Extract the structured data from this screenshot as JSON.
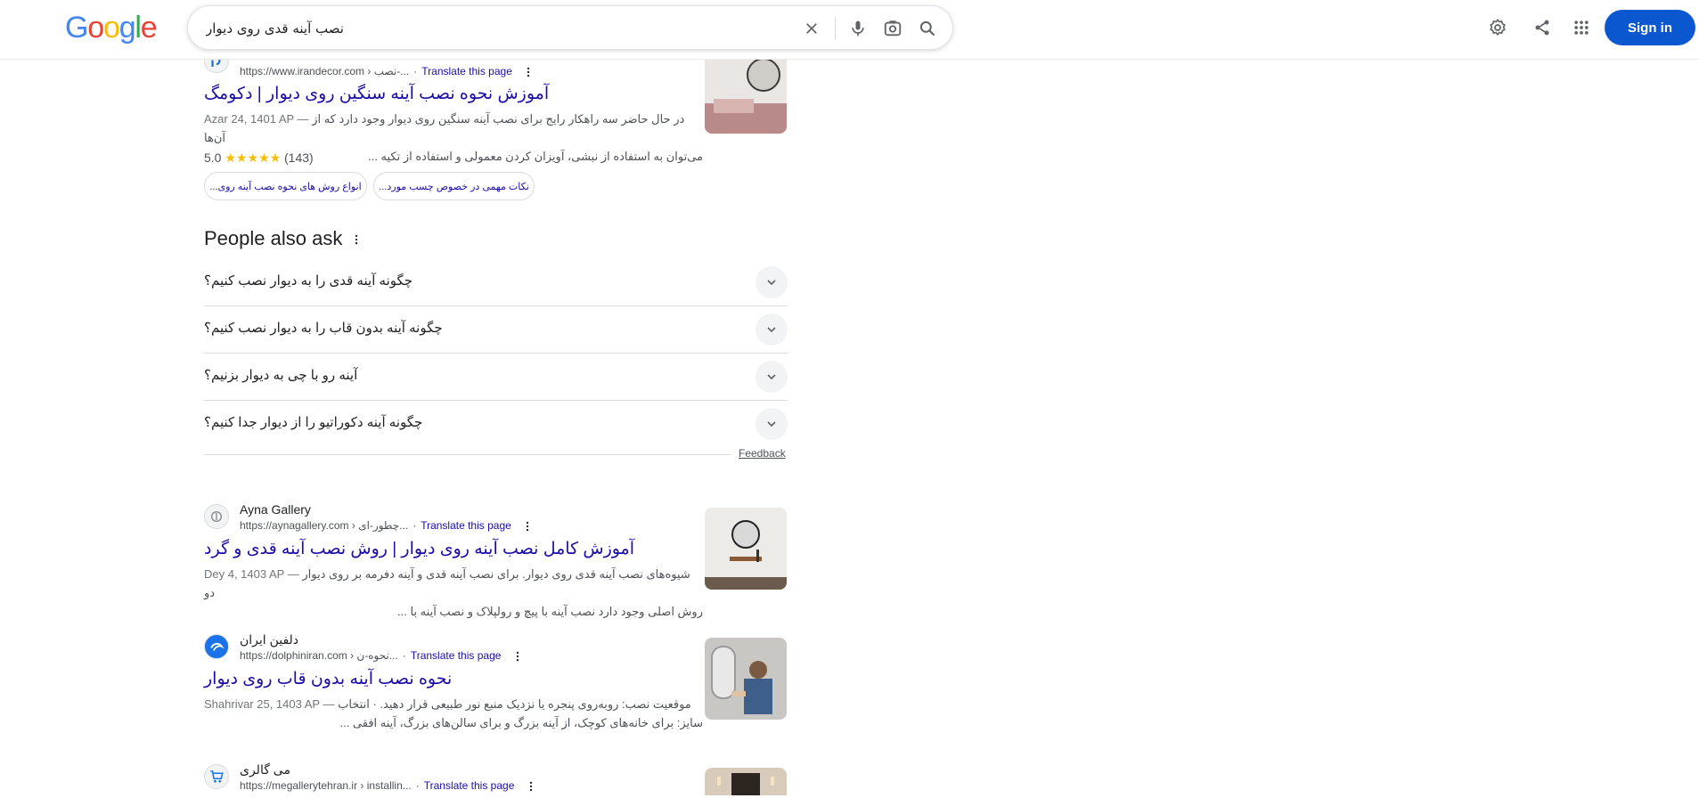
{
  "logo": "Google",
  "search": {
    "query": "نصب آینه قدی روی دیوار"
  },
  "header": {
    "sign_in_label": "Sign in"
  },
  "results_top": {
    "url_host": "https://www.irandecor.com",
    "url_path": " › نصب-...",
    "translate": "Translate this page",
    "title": "آموزش نحوه نصب آینه سنگین روی دیوار | دکومگ",
    "date": "Azar 24, 1401 AP —",
    "snippet_line1": "در حال حاضر سه راهکار رایج برای نصب آینه سنگین روی دیوار وجود دارد که از آن‌ها",
    "snippet_line2": "می‌توان به استفاده از نبشی، آویزان کردن معمولی و استفاده از تکیه ...",
    "rating": "5.0",
    "stars": "★★★★★",
    "rating_count": "(143)",
    "chips": [
      "انواع روش های نحوه نصب آینه روی...",
      "نکات مهمی در خصوص چسب مورد..."
    ]
  },
  "paa": {
    "title": "People also ask",
    "questions": [
      "چگونه آینه قدی را به دیوار نصب کنیم؟",
      "چگونه آینه بدون قاب را به دیوار نصب کنیم؟",
      "آینه رو با چی به دیوار بزنیم؟",
      "چگونه آینه دکوراتیو را از دیوار جدا کنیم؟"
    ],
    "feedback": "Feedback"
  },
  "results": [
    {
      "site_name": "Ayna Gallery",
      "url_host": "https://aynagallery.com",
      "url_path": " › چطور-ای...",
      "translate": "Translate this page",
      "title": "آموزش کامل نصب آینه روی دیوار | روش نصب آینه قدی و گرد",
      "date": "Dey 4, 1403 AP —",
      "snippet_line1": "شیوه‌های نصب آینه قدی روی دیوار. برای نصب آینه قدی و آینه دفرمه بر روی دیوار دو",
      "snippet_line2": "روش اصلی وجود دارد نصب آینه با پیچ و رولپلاک و نصب آینه با ..."
    },
    {
      "site_name": "دلفین ایران",
      "url_host": "https://dolphiniran.com",
      "url_path": " › نحوه-ن...",
      "translate": "Translate this page",
      "title": "نحوه نصب آینه بدون قاب روی دیوار",
      "date": "Shahrivar 25, 1403 AP —",
      "snippet_line1": "موقعیت نصب: روبه‌روی پنجره یا نزدیک منبع نور طبیعی قرار دهید. · انتخاب",
      "snippet_line2": "سایز: برای خانه‌های کوچک، از آینه بزرگ و برای سالن‌های بزرگ، آینه افقی ..."
    },
    {
      "site_name": "می گالری",
      "url_host": "https://megallerytehran.ir",
      "url_path": " › installin...",
      "translate": "Translate this page"
    }
  ]
}
